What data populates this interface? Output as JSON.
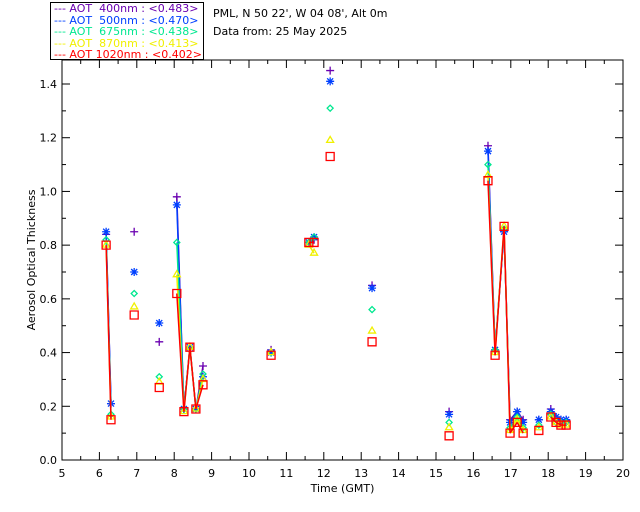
{
  "header": {
    "location": "PML, N 50 22', W 04 08', Alt 0m",
    "date": "Data from: 25 May 2025"
  },
  "chart_data": {
    "type": "scatter",
    "xlabel": "Time (GMT)",
    "ylabel": "Aerosol Optical Thickness",
    "xlim": [
      5,
      20
    ],
    "ylim": [
      0,
      1.45
    ],
    "xticks": [
      "5",
      "6",
      "7",
      "8",
      "9",
      "10",
      "11",
      "12",
      "13",
      "14",
      "15",
      "16",
      "17",
      "18",
      "19",
      "20"
    ],
    "yticks": [
      "0.0",
      "0.2",
      "0.4",
      "0.6",
      "0.8",
      "1.0",
      "1.2",
      "1.4"
    ],
    "legend_position": "top-left outside",
    "x": [
      6.18,
      6.31,
      6.93,
      7.6,
      8.07,
      8.26,
      8.42,
      8.58,
      8.77,
      10.59,
      11.6,
      11.74,
      12.17,
      13.29,
      15.35,
      16.39,
      16.58,
      16.82,
      16.98,
      17.17,
      17.33,
      17.75,
      18.07,
      18.21,
      18.34,
      18.48
    ],
    "series": [
      {
        "name": "AOT  400nm : <0.483>",
        "color": "#6a00b0",
        "marker": "plus",
        "values": [
          0.84,
          0.21,
          0.85,
          0.44,
          0.98,
          0.19,
          0.42,
          0.19,
          0.35,
          0.41,
          0.81,
          0.82,
          1.45,
          0.65,
          0.18,
          1.17,
          0.41,
          0.85,
          0.15,
          0.18,
          0.15,
          0.15,
          0.19,
          0.16,
          0.15,
          0.15
        ]
      },
      {
        "name": "AOT  500nm : <0.470>",
        "color": "#0040ff",
        "marker": "star",
        "values": [
          0.85,
          0.21,
          0.7,
          0.51,
          0.95,
          0.19,
          0.42,
          0.19,
          0.31,
          0.4,
          0.81,
          0.83,
          1.41,
          0.64,
          0.17,
          1.15,
          0.41,
          0.85,
          0.14,
          0.18,
          0.14,
          0.15,
          0.18,
          0.16,
          0.15,
          0.15
        ]
      },
      {
        "name": "AOT  675nm : <0.438>",
        "color": "#00e890",
        "marker": "diamond",
        "values": [
          0.82,
          0.17,
          0.62,
          0.31,
          0.81,
          0.19,
          0.42,
          0.19,
          0.32,
          0.4,
          0.81,
          0.83,
          1.31,
          0.56,
          0.14,
          1.1,
          0.41,
          0.86,
          0.12,
          0.16,
          0.12,
          0.13,
          0.17,
          0.14,
          0.14,
          0.14
        ]
      },
      {
        "name": "AOT  870nm : <0.413>",
        "color": "#f0f000",
        "marker": "triangle",
        "values": [
          0.8,
          0.16,
          0.57,
          0.29,
          0.69,
          0.18,
          0.42,
          0.19,
          0.3,
          0.4,
          0.8,
          0.77,
          1.19,
          0.48,
          0.12,
          1.06,
          0.4,
          0.87,
          0.11,
          0.15,
          0.11,
          0.12,
          0.16,
          0.14,
          0.13,
          0.13
        ]
      },
      {
        "name": "AOT 1020nm : <0.402>",
        "color": "#ff0000",
        "marker": "square",
        "values": [
          0.8,
          0.15,
          0.54,
          0.27,
          0.62,
          0.18,
          0.42,
          0.19,
          0.28,
          0.39,
          0.81,
          0.81,
          1.13,
          0.44,
          0.09,
          1.04,
          0.39,
          0.87,
          0.1,
          0.14,
          0.1,
          0.11,
          0.16,
          0.14,
          0.13,
          0.13
        ]
      }
    ]
  }
}
